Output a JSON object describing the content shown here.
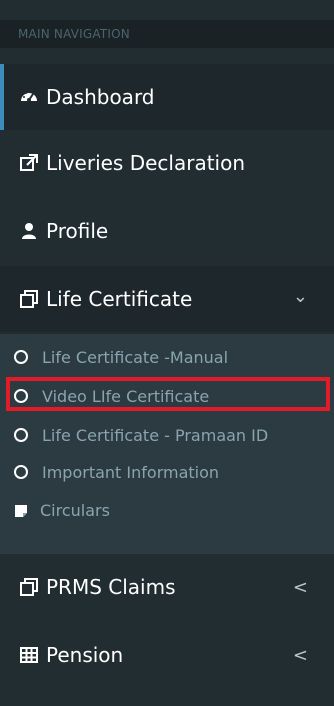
{
  "sidebar": {
    "header": "MAIN NAVIGATION",
    "items": [
      {
        "label": "Dashboard",
        "icon": "dashboard-gauge-icon"
      },
      {
        "label": "Liveries Declaration",
        "icon": "external-link-icon"
      },
      {
        "label": "Profile",
        "icon": "user-icon"
      },
      {
        "label": "Life Certificate",
        "icon": "clone-icon",
        "chevron": "⌄"
      },
      {
        "label": "PRMS Claims",
        "icon": "clone-icon",
        "chevron": "<"
      },
      {
        "label": "Pension",
        "icon": "table-icon",
        "chevron": "<"
      }
    ],
    "submenu": [
      {
        "label": "Life Certificate -Manual",
        "icon": "circle-outline-icon"
      },
      {
        "label": "Video LIfe Certificate",
        "icon": "circle-outline-icon"
      },
      {
        "label": "Life Certificate - Pramaan ID",
        "icon": "circle-outline-icon"
      },
      {
        "label": "Important Information",
        "icon": "circle-outline-icon"
      },
      {
        "label": "Circulars",
        "icon": "sticky-note-icon"
      }
    ]
  },
  "colors": {
    "sidebar_bg": "#222d32",
    "active_bg": "#1e282c",
    "submenu_bg": "#2c3b41",
    "accent": "#3c8dbc",
    "highlight": "#e01b2a"
  }
}
